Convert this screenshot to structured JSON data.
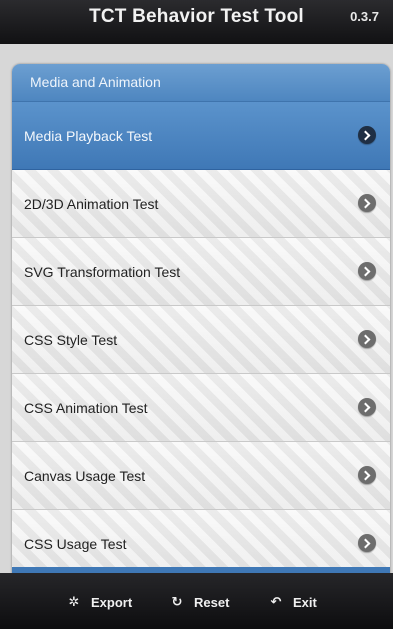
{
  "header": {
    "title": "TCT Behavior Test Tool",
    "version": "0.3.7"
  },
  "section": {
    "title": "Media and Animation"
  },
  "list": {
    "items": [
      {
        "label": "Media Playback Test"
      },
      {
        "label": "2D/3D Animation Test"
      },
      {
        "label": "SVG Transformation Test"
      },
      {
        "label": "CSS Style Test"
      },
      {
        "label": "CSS Animation Test"
      },
      {
        "label": "Canvas Usage Test"
      },
      {
        "label": "CSS Usage Test"
      }
    ]
  },
  "footer": {
    "export_label": "Export",
    "reset_label": "Reset",
    "exit_label": "Exit"
  },
  "icons": {
    "row_arrow": "chevron-right-circle-icon",
    "export": "gear-icon",
    "reset": "refresh-icon",
    "exit": "back-arrow-icon"
  }
}
